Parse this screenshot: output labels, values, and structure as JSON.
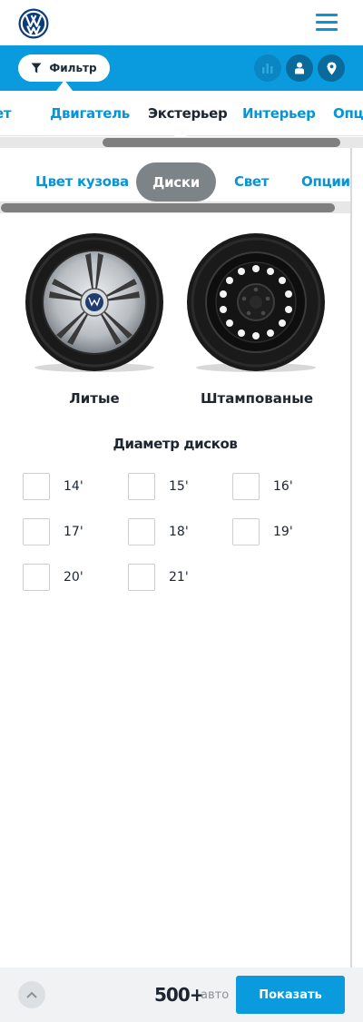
{
  "header": {
    "logo_icon": "vw-logo-icon",
    "menu_icon": "hamburger-menu-icon"
  },
  "filterbar": {
    "filter_label": "Фильтр",
    "filter_icon": "funnel-icon",
    "actions": [
      "compare-chart-icon",
      "user-icon",
      "location-pin-icon"
    ]
  },
  "categories": [
    "Пакет",
    "Двигатель",
    "Экстерьер",
    "Интерьер",
    "Опции"
  ],
  "active_category": "Экстерьер",
  "subtabs": [
    "Цвет кузова",
    "Диски",
    "Свет",
    "Опции"
  ],
  "active_subtab": "Диски",
  "wheels": [
    {
      "label": "Литые",
      "icon": "alloy-wheel-icon"
    },
    {
      "label": "Штампованые",
      "icon": "steel-wheel-icon"
    }
  ],
  "diameter": {
    "title": "Диаметр дисков",
    "options": [
      "14'",
      "15'",
      "16'",
      "17'",
      "18'",
      "19'",
      "20'",
      "21'"
    ]
  },
  "footer": {
    "count": "500+",
    "count_unit": "авто",
    "show_label": "Показать",
    "up_icon": "chevron-up-icon"
  },
  "colors": {
    "accent": "#0a9bdf",
    "dark": "#1d2530",
    "pill": "#7d8487"
  }
}
